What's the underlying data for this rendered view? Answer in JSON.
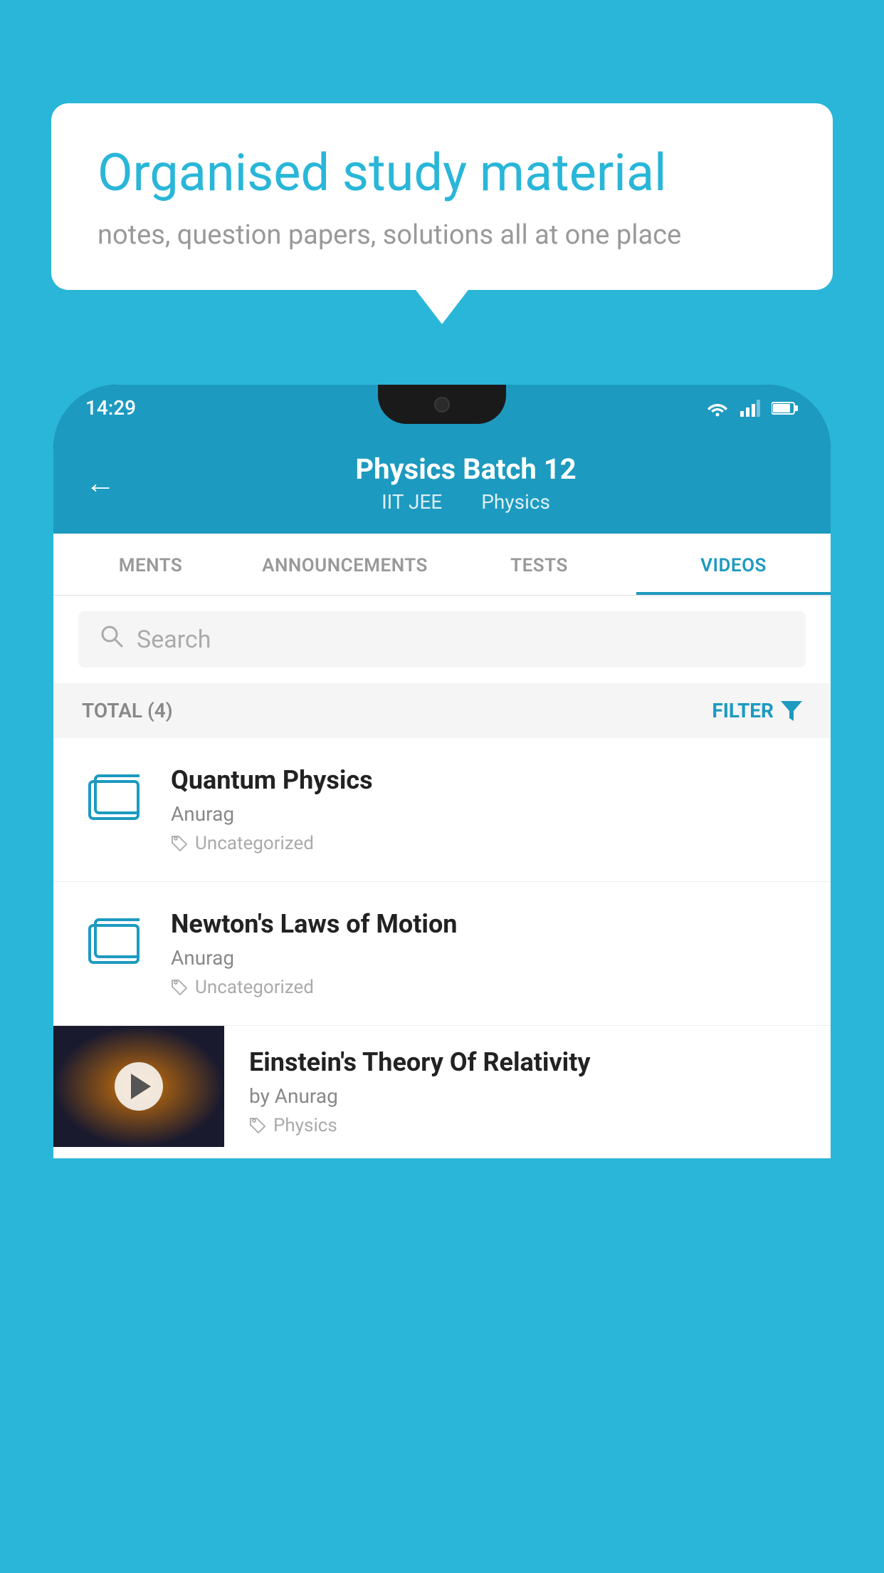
{
  "background_color": "#29b6d8",
  "speech_bubble": {
    "title": "Organised study material",
    "subtitle": "notes, question papers, solutions all at one place"
  },
  "phone": {
    "status_bar": {
      "time": "14:29",
      "icons": [
        "wifi",
        "signal",
        "battery"
      ]
    },
    "header": {
      "back_label": "←",
      "title": "Physics Batch 12",
      "subtitle_left": "IIT JEE",
      "subtitle_right": "Physics"
    },
    "tabs": [
      {
        "label": "MENTS",
        "active": false
      },
      {
        "label": "ANNOUNCEMENTS",
        "active": false
      },
      {
        "label": "TESTS",
        "active": false
      },
      {
        "label": "VIDEOS",
        "active": true
      }
    ],
    "search": {
      "placeholder": "Search"
    },
    "filter_bar": {
      "total_label": "TOTAL (4)",
      "filter_label": "FILTER"
    },
    "items": [
      {
        "title": "Quantum Physics",
        "author": "Anurag",
        "tag": "Uncategorized",
        "type": "folder"
      },
      {
        "title": "Newton's Laws of Motion",
        "author": "Anurag",
        "tag": "Uncategorized",
        "type": "folder"
      },
      {
        "title": "Einstein's Theory Of Relativity",
        "author": "by Anurag",
        "tag": "Physics",
        "type": "video"
      }
    ]
  }
}
